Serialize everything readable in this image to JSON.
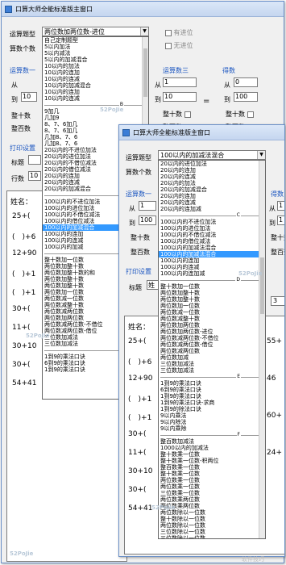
{
  "back": {
    "title": "口算大师全能标准版主窗口",
    "type_label": "运算题型",
    "type_value": "两位数加两位数-进位",
    "count_label": "算数个数",
    "chk_carry": "有进位",
    "chk_nocarry": "无进位",
    "op1_label": "运算数一",
    "op3_label": "运算数三",
    "result_label": "得数",
    "from": "从",
    "to": "到",
    "op3_from": "1",
    "op3_to": "10",
    "res_from": "0",
    "res_to": "100",
    "op1_to": "10",
    "tens": "整十数",
    "hundreds": "整百数",
    "equals": "=",
    "print_label": "打印设置",
    "title_label": "标题",
    "rows_label": "行数",
    "rows_value": "10",
    "name_label": "姓名：",
    "exprs": [
      "25+(",
      "(　)+6",
      "12+90",
      "(　)+1",
      "(　)+1",
      "30+(",
      "11+(",
      "30+10",
      "30+(",
      "54+41"
    ],
    "list": [
      "自己定制题型",
      "5以内加法",
      "5以内减法",
      "5以内的加减混合",
      "10以内的加法",
      "10以内的连加",
      "10以内的连减",
      "10以内的加减混合",
      "10以内的连加",
      "10以内的连减",
      "sep:B",
      "9加几",
      "几加9",
      "8、7、6加几",
      "8、7、6加几",
      "几加8、7、6",
      "几加8、7、6",
      "20以内的不进位加法",
      "20以内的进位加法",
      "20以内的不借位减法",
      "20以内的借位减法",
      "20以内的连加",
      "20以内的连减",
      "20以内的加减混合",
      "sep:C",
      "100以内的不进位加法",
      "100以内的进位加法",
      "100以内的不借位减法",
      "100以内的借位减法",
      "100以内的加减混合",
      "100以内的连加",
      "100以内的连减",
      "100以内的加减",
      "sep:D",
      "整十数加一位数",
      "两位数加整十数",
      "两位数加整十数的和",
      "两位数加整十数",
      "两位数加整十数",
      "两位数加一位数",
      "两位数减一位数",
      "两位数减整十数",
      "两位数减两位数",
      "两位数加两位数",
      "两位数减两位数-不借位",
      "两位数减两位数-借位",
      "三位数加减法",
      "三位数加减法",
      "sep:E",
      "1到9的乘法口诀",
      "6到9的乘法口诀",
      "1到9的乘法口诀"
    ],
    "list_highlight": 29
  },
  "front": {
    "title": "口算大师全能标准版主窗口",
    "type_label": "运算题型",
    "type_value": "100以内的加减法混合",
    "count_label": "算数个数",
    "op1_label": "运算数一",
    "result_label": "得数",
    "from": "从",
    "to": "到",
    "op1_from": "1",
    "op1_to": "100",
    "res_from": "1",
    "res_to": "1",
    "tens": "整十数",
    "hundreds": "整百数",
    "print_label": "打印设置",
    "title_label": "标题",
    "title_value": "姓",
    "rows_value": "3",
    "name_label": "姓名：",
    "exprs": [
      "25+(",
      "(　)+6",
      "12+90",
      "(　)+1",
      "(　)+1",
      "30+(",
      "11+(",
      "30+10",
      "30+(",
      "54+41"
    ],
    "right_nums": [
      "55+",
      "46",
      "60+",
      "24+"
    ],
    "list": [
      "20以内的进位加法",
      "20以内的连加",
      "20以内的连减",
      "20以内的加法",
      "20以内的加减混合",
      "20以内的连加",
      "20以内的连减",
      "20以内的连加减",
      "sep:C",
      "100以内的不进位加法",
      "100以内的进位加法",
      "100以内的不借位减法",
      "100以内的借位减法",
      "100以内的加减法混合",
      "100以内的加减法混合",
      "100以内的连加",
      "100以内的连减",
      "100以内的连加减",
      "sep:D",
      "整十数加一位数",
      "两位数加整十数",
      "两位数加整十数",
      "两位数加一位数",
      "两位数减一位数",
      "两位数减整十数",
      "两位数加两位数",
      "两位数加两位数-进位",
      "两位数减两位数-不借位",
      "两位数减两位数-借位",
      "两位数减两位数",
      "两位数加减",
      "三位数加减法",
      "三位数加减法",
      "sep:E",
      "1到9的乘法口诀",
      "6到9的乘法口诀",
      "1到9的乘法口诀",
      "1到9的乘法口诀-求商",
      "1到9的除法口诀",
      "9以内乘法",
      "9以内除法",
      "9以内乘除",
      "sep:F",
      "整百数加减法",
      "1000以内的加减法",
      "整十数乘一位数",
      "整十数乘一位数-积两位",
      "整百数乘一位数",
      "整十数乘一位数",
      "两位数乘一位数",
      "两位数乘一位数",
      "三位数乘一位数",
      "两位数乘两位数",
      "两位数乘两位数",
      "两位数除以一位数",
      "整十数除以一位数",
      "两位数除以一位数",
      "三位数除以一位数",
      "三位数除以一位数",
      "一位数乘整十数"
    ],
    "list_highlight": 14
  },
  "watermark": "52PoJie",
  "bottom_watermark": "软件技巧"
}
